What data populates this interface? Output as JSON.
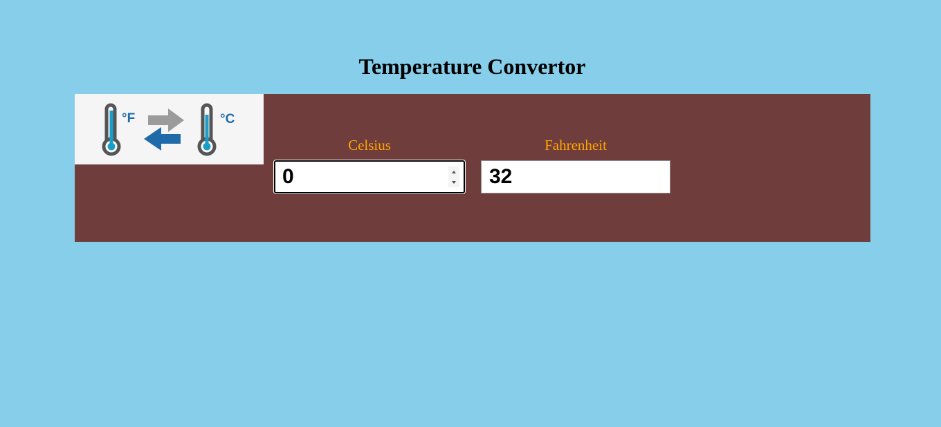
{
  "page": {
    "title": "Temperature Convertor"
  },
  "colors": {
    "background": "#87ceeb",
    "panel": "#6f3d3c",
    "label": "#ffa500",
    "logo_blue": "#1f6aa8",
    "logo_cyan": "#1a9ec9",
    "logo_gray": "#9b9b9b",
    "logo_outline": "#555555"
  },
  "logo": {
    "icon_name": "fahrenheit-celsius-convert-icon",
    "fahrenheit_unit": "°F",
    "celsius_unit": "°C"
  },
  "celsius": {
    "label": "Celsius",
    "value": "0"
  },
  "fahrenheit": {
    "label": "Fahrenheit",
    "value": "32"
  }
}
